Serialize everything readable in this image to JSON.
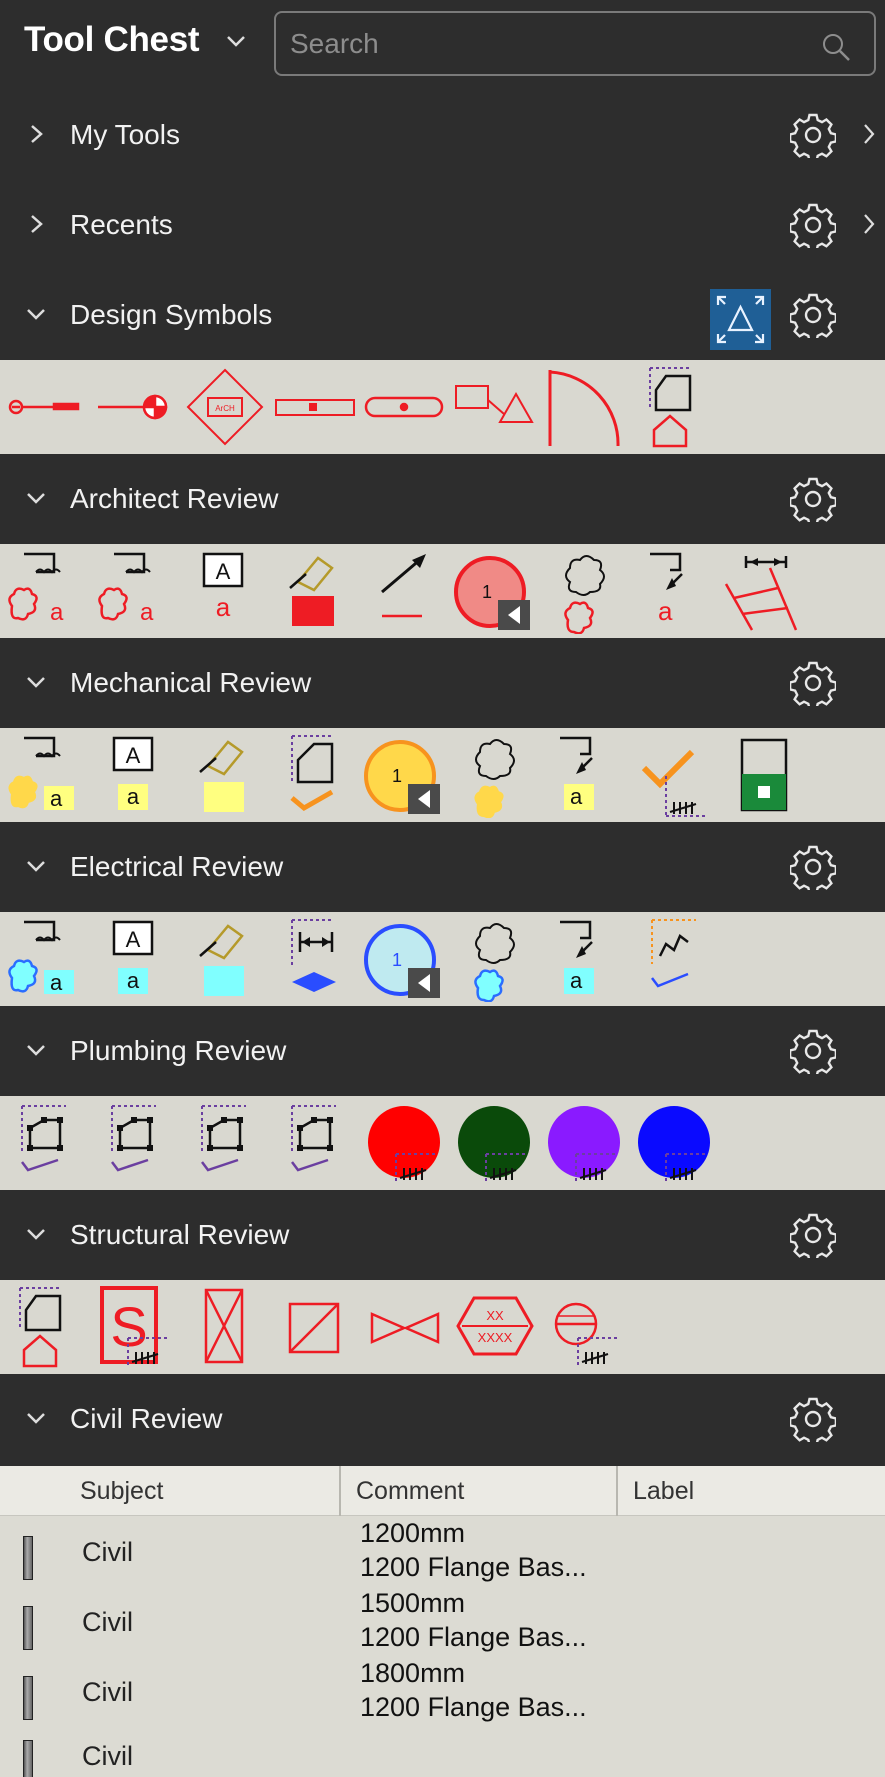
{
  "header": {
    "title": "Tool Chest",
    "search_placeholder": "Search"
  },
  "sections": [
    {
      "label": "My Tools",
      "expanded": false
    },
    {
      "label": "Recents",
      "expanded": false
    },
    {
      "label": "Design Symbols",
      "expanded": true
    },
    {
      "label": "Architect Review",
      "expanded": true
    },
    {
      "label": "Mechanical Review",
      "expanded": true
    },
    {
      "label": "Electrical Review",
      "expanded": true
    },
    {
      "label": "Plumbing Review",
      "expanded": true
    },
    {
      "label": "Structural Review",
      "expanded": true
    },
    {
      "label": "Civil Review",
      "expanded": true
    }
  ],
  "civil_table": {
    "columns": [
      "Subject",
      "Comment",
      "Label"
    ],
    "rows": [
      {
        "subject": "Civil",
        "comment_line1": "1200mm",
        "comment_line2": "1200 Flange Bas..."
      },
      {
        "subject": "Civil",
        "comment_line1": "1500mm",
        "comment_line2": "1200 Flange Bas..."
      },
      {
        "subject": "Civil",
        "comment_line1": "1800mm",
        "comment_line2": "1200 Flange Bas..."
      },
      {
        "subject": "Civil",
        "comment_line1": "",
        "comment_line2": ""
      }
    ]
  },
  "design_symbol_text": {
    "hex_top": "XX",
    "hex_bottom": "XXXX",
    "diamond_center": "ArCH",
    "callout_number": "1",
    "tag_letter": "A",
    "sub_letter": "a",
    "structural_letter": "S"
  },
  "colors": {
    "background": "#2d2d2d",
    "tool_strip": "#d9d8d0",
    "accent_blue": "#1f5f96",
    "markup_red": "#ee1c24",
    "highlight_yellow": "#ffff80",
    "highlight_cyan": "#80ffff"
  }
}
